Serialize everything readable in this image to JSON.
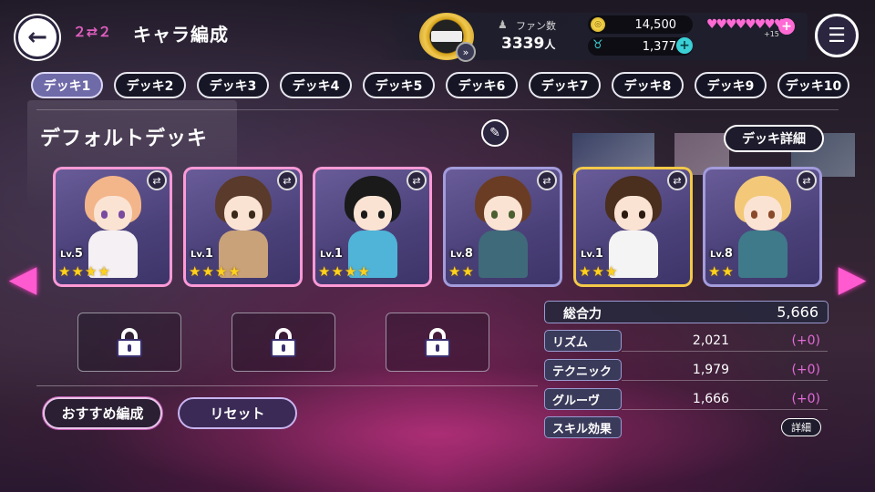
{
  "header": {
    "title": "キャラ編成",
    "title_icon": "２⇄２",
    "back_icon": "←",
    "menu_icon": "☰",
    "fans": {
      "label": "ファン数",
      "value": "3339",
      "unit": "人"
    },
    "coins": "14,500",
    "gems": "1,377",
    "hearts": "♥♥♥♥♥♥♥♥",
    "hearts_count": "+15"
  },
  "tabs": [
    "デッキ1",
    "デッキ2",
    "デッキ3",
    "デッキ4",
    "デッキ5",
    "デッキ6",
    "デッキ7",
    "デッキ8",
    "デッキ9",
    "デッキ10"
  ],
  "deck": {
    "name": "デフォルトデッキ",
    "detail_label": "デッキ詳細",
    "edit_icon": "✎"
  },
  "cards": [
    {
      "level_prefix": "Lv.",
      "level": "5",
      "stars": "★★★★",
      "frame": "#ff9ad6",
      "hair": "#f3b58a",
      "eye": "#7a4aa0",
      "outfit": "#f4f0f4"
    },
    {
      "level_prefix": "Lv.",
      "level": "1",
      "stars": "★★★★",
      "frame": "#ff9ad6",
      "hair": "#5a3a2a",
      "eye": "#3a2a1a",
      "outfit": "#c9a27a"
    },
    {
      "level_prefix": "Lv.",
      "level": "1",
      "stars": "★★★★",
      "frame": "#ff9ad6",
      "hair": "#1a1a1a",
      "eye": "#1a1a1a",
      "outfit": "#4fb4d8"
    },
    {
      "level_prefix": "Lv.",
      "level": "8",
      "stars": "★★",
      "frame": "#a39cdc",
      "hair": "#6a3c24",
      "eye": "#4a6030",
      "outfit": "#3f6a7a"
    },
    {
      "level_prefix": "Lv.",
      "level": "1",
      "stars": "★★★",
      "frame": "#f3c948",
      "hair": "#4a2e1e",
      "eye": "#2a1a10",
      "outfit": "#f4f4f4"
    },
    {
      "level_prefix": "Lv.",
      "level": "8",
      "stars": "★★",
      "frame": "#a39cdc",
      "hair": "#f3c878",
      "eye": "#8a4a2a",
      "outfit": "#3f7a8a"
    }
  ],
  "buttons": {
    "recommend": "おすすめ編成",
    "reset": "リセット",
    "skill_detail": "詳細"
  },
  "stats": {
    "total_label": "総合力",
    "total_value": "5,666",
    "rows": [
      {
        "label": "リズム",
        "value": "2,021",
        "bonus": "(+0)"
      },
      {
        "label": "テクニック",
        "value": "1,979",
        "bonus": "(+0)"
      },
      {
        "label": "グルーヴ",
        "value": "1,666",
        "bonus": "(+0)"
      }
    ],
    "skill_label": "スキル効果"
  }
}
